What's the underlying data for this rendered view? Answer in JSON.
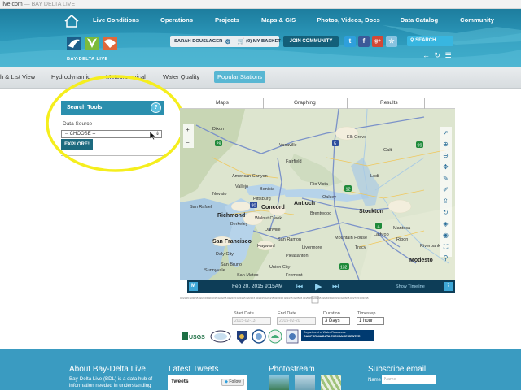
{
  "browser": {
    "url_tail": "live.com",
    "title_sep": " — ",
    "title": "BAY DELTA LIVE"
  },
  "nav": {
    "items": [
      "Live Conditions",
      "Operations",
      "Projects",
      "Maps & GIS",
      "Photos, Videos, Docs",
      "Data Catalog",
      "Community"
    ]
  },
  "logo": {
    "text": "BAY-DELTA LIVE"
  },
  "user": {
    "name": "SARAH DOUSLAGER",
    "basket": "(0) MY BASKET",
    "join": "JOIN COMMUNITY"
  },
  "social": {
    "twitter": "t",
    "facebook": "f",
    "google": "g+"
  },
  "search": {
    "label": "SEARCH"
  },
  "tabs": [
    "h & List View",
    "Hydrodynamic",
    "Meteorological",
    "Water Quality",
    "Popular Stations"
  ],
  "search_tools": {
    "title": "Search Tools",
    "help": "?",
    "data_source_label": "Data Source",
    "select_value": "-- CHOOSE --",
    "explore": "EXPLORE!"
  },
  "map_tabs": [
    "Maps",
    "Graphing",
    "Results"
  ],
  "map": {
    "cities": {
      "elk_grove": "Elk Grove",
      "fairfield": "Fairfield",
      "vacaville": "Vacaville",
      "american_canyon": "American Canyon",
      "vallejo": "Vallejo",
      "benicia": "Benicia",
      "concord": "Concord",
      "antioch": "Antioch",
      "brentwood": "Brentwood",
      "stockton": "Stockton",
      "lodi": "Lodi",
      "richmond": "Richmond",
      "berkeley": "Berkeley",
      "walnut_creek": "Walnut Creek",
      "san_francisco": "San Francisco",
      "daly_city": "Daly City",
      "hayward": "Hayward",
      "san_ramon": "San Ramon",
      "danville": "Danville",
      "livermore": "Livermore",
      "tracy": "Tracy",
      "manteca": "Manteca",
      "lathrop": "Lathrop",
      "ripon": "Ripon",
      "riverbank": "Riverbank",
      "modesto": "Modesto",
      "pleasanton": "Pleasanton",
      "fremont": "Fremont",
      "union_city": "Union City",
      "san_mateo": "San Mateo",
      "sunnyvale": "Sunnyvale",
      "san_bruno": "San Bruno",
      "novato": "Novato",
      "san_rafael": "San Rafael",
      "pittsburg": "Pittsburg",
      "galt": "Galt",
      "dixon": "Dixon",
      "rio_vista": "Rio Vista",
      "oakley": "Oakley",
      "mountain_house": "Mountain House"
    },
    "highways": {
      "i5": "5",
      "h12": "12",
      "h29": "29",
      "i80": "80",
      "h4": "4",
      "h99": "99",
      "h132": "132"
    }
  },
  "timeline": {
    "mode": "M",
    "date": "Feb 20, 2015 9:15AM",
    "prev": "◀",
    "play": "▶",
    "next": "▶",
    "show": "Show Timeline",
    "help": "?"
  },
  "ticks_text": "02/21/15 02/21/15 02/21/15 02/22/15 02/22/15 02/22/15 02/23/15 02/23/15 02/23/15 02/24/15 02/24/15 02/24/15 02/25/15 02/25/15 02/25/15 02/26/15 02/26/15 02/26/15 02/27/15 02/27/15",
  "date_controls": {
    "start_label": "Start Date",
    "start_value": "2015-02-13",
    "end_label": "End Date",
    "end_value": "2015-02-20",
    "duration_label": "Duration",
    "duration_value": "3 Days",
    "timestep_label": "Timestep",
    "timestep_value": "1 hour"
  },
  "logos": {
    "usgs": "USGS",
    "dwr_line1": "Department of Water Resources",
    "dwr_line2": "CALIFORNIA DATA EXCHANGE CENTER"
  },
  "footer": {
    "about_title": "About Bay-Delta Live",
    "about_line1": "Bay-Delta Live (BDL) is a data hub of",
    "about_line2": "information needed in understanding",
    "tweets_title": "Latest Tweets",
    "tweets_label": "Tweets",
    "follow_label": "Follow",
    "photostream_title": "Photostream",
    "subscribe_title": "Subscribe email",
    "name_label": "Name",
    "name_placeholder": "Name"
  },
  "colors": {
    "header": "#2a95b7",
    "accent": "#59b7d3",
    "footer": "#3a9bc1",
    "highlight": "#f5ee1d"
  }
}
